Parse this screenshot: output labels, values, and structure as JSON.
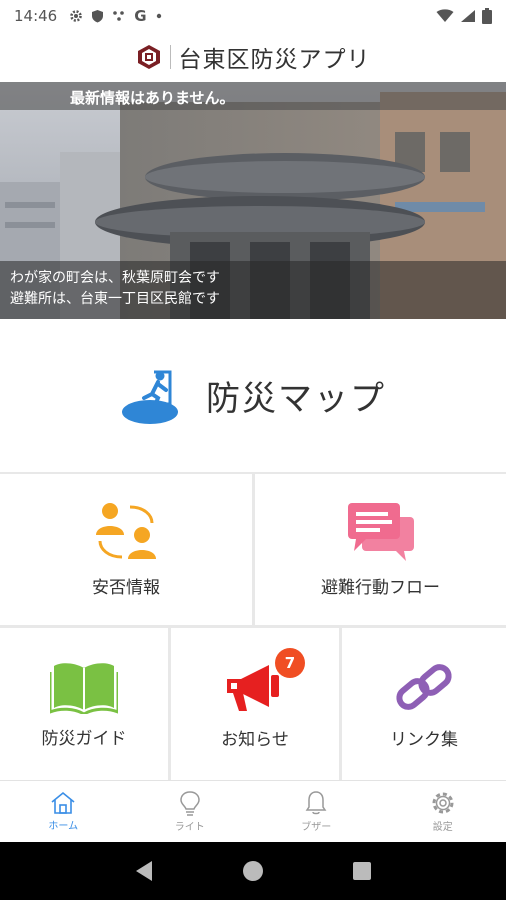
{
  "status_bar": {
    "time": "14:46",
    "left_icons": [
      "gear-icon",
      "shield-icon",
      "dots-icon",
      "google-icon",
      "dot-icon"
    ],
    "google_letter": "G",
    "right_icons": [
      "wifi-icon",
      "signal-icon",
      "battery-icon"
    ]
  },
  "app": {
    "title": "台東区防災アプリ",
    "logo": "ward-emblem"
  },
  "hero": {
    "news": "最新情報はありません。",
    "caption_line1": "わが家の町会は、秋葉原町会です",
    "caption_line2": "避難所は、台東一丁目区民館です"
  },
  "map": {
    "label": "防災マップ",
    "icon": "evacuation-runner-icon"
  },
  "menu": {
    "safety": {
      "label": "安否情報",
      "icon": "people-sync-icon"
    },
    "flow": {
      "label": "避難行動フロー",
      "icon": "chat-bubbles-icon"
    },
    "guide": {
      "label": "防災ガイド",
      "icon": "book-icon"
    },
    "notice": {
      "label": "お知らせ",
      "icon": "megaphone-icon",
      "badge": "7"
    },
    "links": {
      "label": "リンク集",
      "icon": "chain-link-icon"
    }
  },
  "bottom_nav": [
    {
      "label": "ホーム",
      "icon": "home-icon",
      "active": true
    },
    {
      "label": "ライト",
      "icon": "bulb-icon",
      "active": false
    },
    {
      "label": "ブザー",
      "icon": "bell-icon",
      "active": false
    },
    {
      "label": "設定",
      "icon": "gear-icon",
      "active": false
    }
  ],
  "colors": {
    "accent": "#3a8ee6",
    "map_icon": "#2f86d6",
    "safety": "#f5a623",
    "flow": "#f06b8f",
    "guide": "#7ac143",
    "notice": "#e62020",
    "badge": "#f04e23",
    "links": "#8e5fb5"
  }
}
